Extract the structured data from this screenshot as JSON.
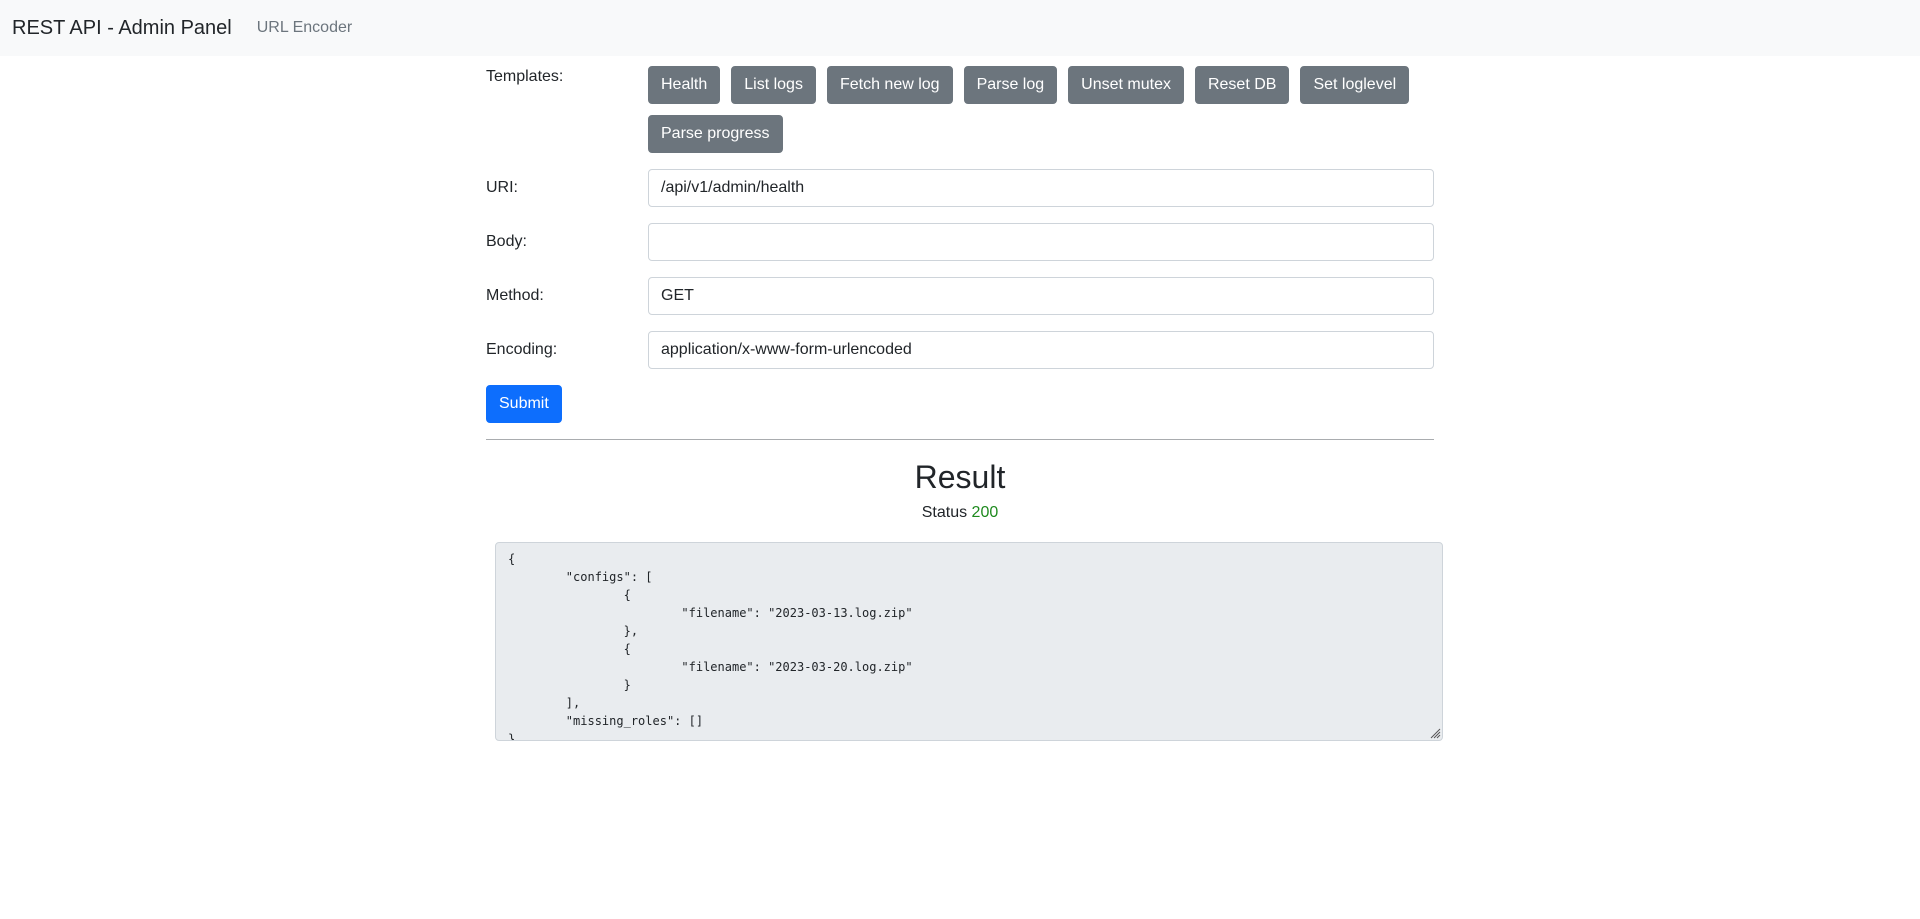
{
  "navbar": {
    "brand": "REST API - Admin Panel",
    "link": "URL Encoder"
  },
  "form": {
    "templates_label": "Templates:",
    "templates": [
      "Health",
      "List logs",
      "Fetch new log",
      "Parse log",
      "Unset mutex",
      "Reset DB",
      "Set loglevel",
      "Parse progress"
    ],
    "uri_label": "URI:",
    "uri_value": "/api/v1/admin/health",
    "body_label": "Body:",
    "body_value": "",
    "method_label": "Method:",
    "method_value": "GET",
    "encoding_label": "Encoding:",
    "encoding_value": "application/x-www-form-urlencoded",
    "submit_label": "Submit"
  },
  "result": {
    "title": "Result",
    "status_label": "Status",
    "status_code": "200",
    "body": "{\n\t\"configs\": [\n\t\t{\n\t\t\t\"filename\": \"2023-03-13.log.zip\"\n\t\t},\n\t\t{\n\t\t\t\"filename\": \"2023-03-20.log.zip\"\n\t\t}\n\t],\n\t\"missing_roles\": []\n}"
  },
  "colors": {
    "primary": "#0d6efd",
    "secondary": "#6c757d",
    "success": "#1e8a1e",
    "navbar_bg": "#f8f9fa"
  }
}
